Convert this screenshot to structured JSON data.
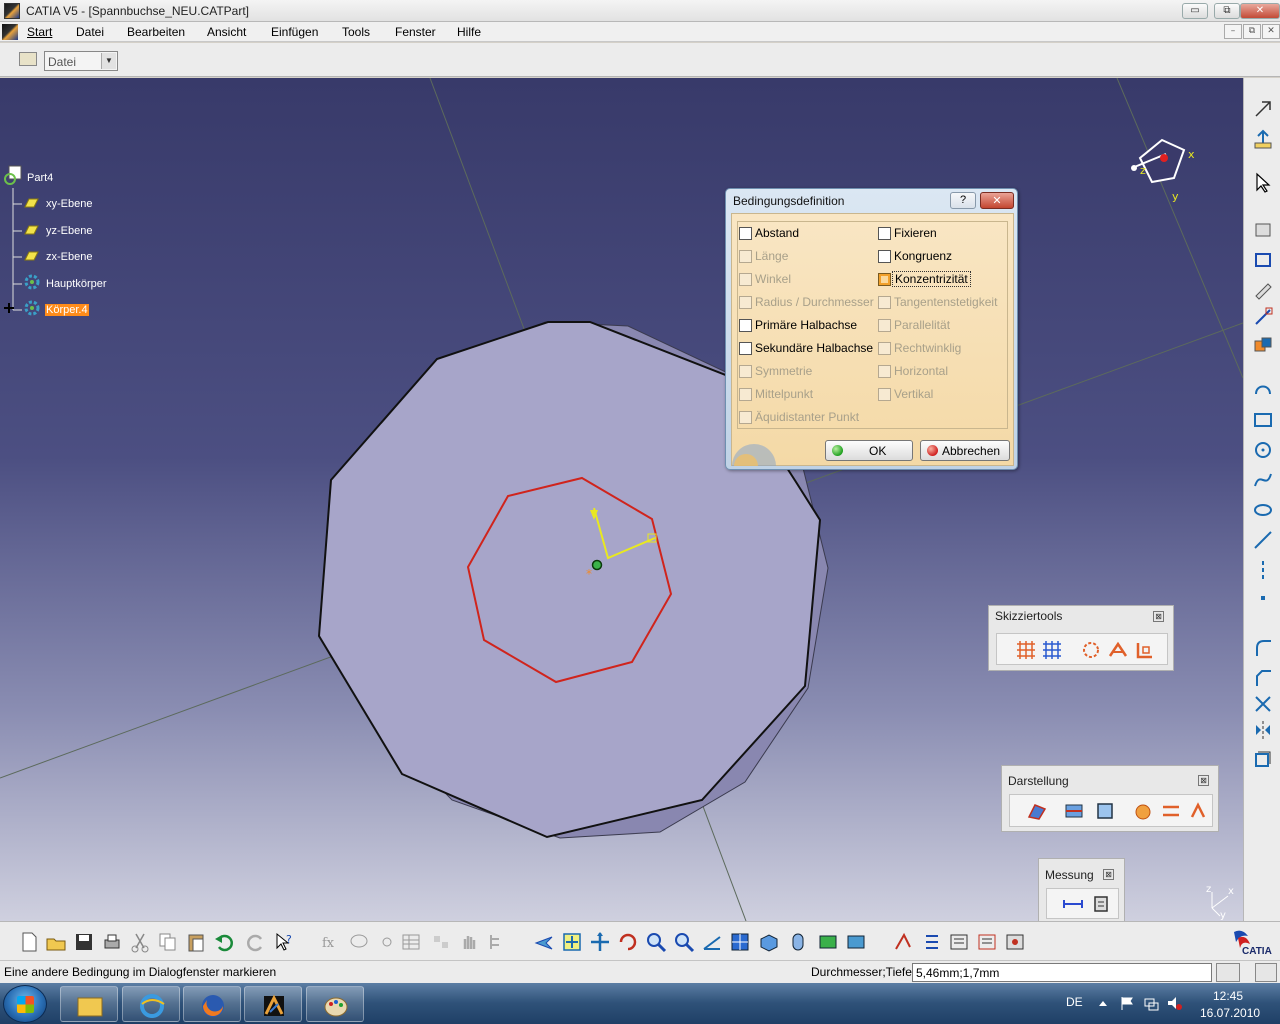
{
  "window": {
    "title": "CATIA V5 - [Spannbuchse_NEU.CATPart]",
    "minimize_glyph": "▭",
    "restore_glyph": "⧉",
    "close_glyph": "✕"
  },
  "menu": {
    "items": [
      "Start",
      "Datei",
      "Bearbeiten",
      "Ansicht",
      "Einfügen",
      "Tools",
      "Fenster",
      "Hilfe"
    ],
    "mdi_minimize": "–",
    "mdi_restore": "⧉",
    "mdi_close": "✕"
  },
  "toolbar": {
    "workbench_combo_value": "Datei"
  },
  "spec_tree": {
    "root": "Part4",
    "items": [
      "xy-Ebene",
      "yz-Ebene",
      "zx-Ebene",
      "Hauptkörper",
      "Körper.4"
    ],
    "selected": "Körper.4"
  },
  "compass": {
    "x_label": "x",
    "y_label": "y",
    "z_label": "z"
  },
  "axis_triad": {
    "x_label": "x",
    "y_label": "y",
    "z_label": "z"
  },
  "dialog": {
    "title": "Bedingungsdefinition",
    "help_label": "?",
    "close_label": "✕",
    "left_column": [
      {
        "label": "Abstand",
        "enabled": true,
        "checked": false
      },
      {
        "label": "Länge",
        "enabled": false,
        "checked": false
      },
      {
        "label": "Winkel",
        "enabled": false,
        "checked": false
      },
      {
        "label": "Radius / Durchmesser",
        "enabled": false,
        "checked": false
      },
      {
        "label": "Primäre Halbachse",
        "enabled": true,
        "checked": false
      },
      {
        "label": "Sekundäre Halbachse",
        "enabled": true,
        "checked": false
      },
      {
        "label": "Symmetrie",
        "enabled": false,
        "checked": false
      },
      {
        "label": "Mittelpunkt",
        "enabled": false,
        "checked": false
      },
      {
        "label": "Äquidistanter Punkt",
        "enabled": false,
        "checked": false
      }
    ],
    "right_column": [
      {
        "label": "Fixieren",
        "enabled": true,
        "checked": false
      },
      {
        "label": "Kongruenz",
        "enabled": true,
        "checked": false
      },
      {
        "label": "Konzentrizität",
        "enabled": true,
        "checked": true
      },
      {
        "label": "Tangentenstetigkeit",
        "enabled": false,
        "checked": false
      },
      {
        "label": "Parallelität",
        "enabled": false,
        "checked": false
      },
      {
        "label": "Rechtwinklig",
        "enabled": false,
        "checked": false
      },
      {
        "label": "Horizontal",
        "enabled": false,
        "checked": false
      },
      {
        "label": "Vertikal",
        "enabled": false,
        "checked": false
      }
    ],
    "ok_label": "OK",
    "cancel_label": "Abbrechen"
  },
  "floating_toolbars": {
    "sketch_tools": {
      "title": "Skizziertools",
      "close": "⊠"
    },
    "display": {
      "title": "Darstellung",
      "close": "⊠"
    },
    "measure": {
      "title": "Messung",
      "close": "⊠"
    }
  },
  "status_bar": {
    "message": "Eine andere Bedingung im Dialogfenster markieren",
    "command_label": "Durchmesser;Tiefe",
    "command_value": "5,46mm;1,7mm"
  },
  "brand": {
    "logo_text": "CATIA"
  },
  "taskbar": {
    "language": "DE",
    "time": "12:45",
    "date": "16.07.2010"
  },
  "colors": {
    "selection_orange": "#ff8c1a",
    "sketch_red": "#d0241c",
    "sketch_axis_yellow": "#e8e820",
    "viewport_top": "#383a6a",
    "part_face": "#a7a5c9"
  }
}
